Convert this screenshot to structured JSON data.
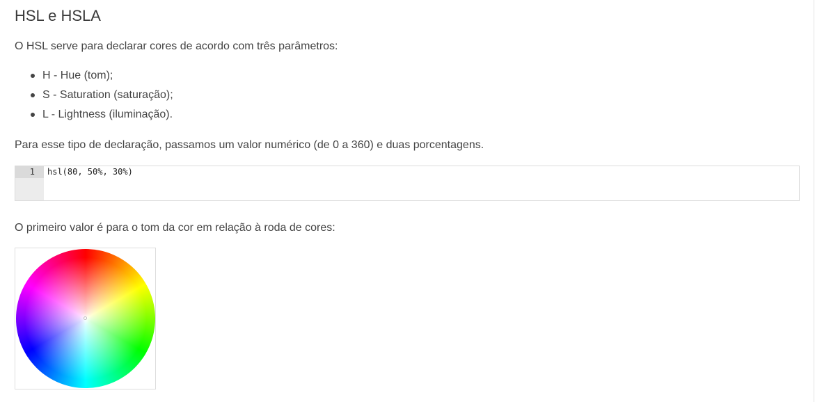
{
  "article": {
    "title": "HSL e HSLA",
    "intro": "O HSL serve para declarar cores de acordo com três parâmetros:",
    "params": [
      {
        "label": "H - Hue (tom);"
      },
      {
        "label": "S - Saturation (saturação);"
      },
      {
        "label": "L - Lightness (iluminação)."
      }
    ],
    "declaration_text": "Para esse tipo de declaração, passamos um valor numérico (de 0 a 360) e duas porcentagens.",
    "code": {
      "line_number": "1",
      "line": "hsl(80, 50%, 30%)"
    },
    "wheel_text": "O primeiro valor é para o tom da cor em relação à roda de cores:",
    "image": {
      "icon": "color-wheel"
    }
  },
  "colors": {
    "text": "#444444",
    "title": "#3a3a3a",
    "gutter": "#ececec",
    "gutter_active": "#dadada",
    "border": "#dcdcdc"
  }
}
